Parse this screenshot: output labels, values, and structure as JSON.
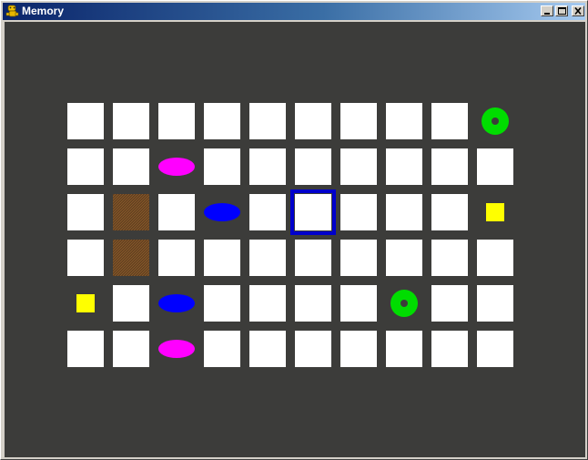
{
  "window": {
    "title": "Memory",
    "controls": [
      "minimize",
      "maximize",
      "close"
    ]
  },
  "colors": {
    "board_background": "#3c3c3a",
    "covered_tile": "#ffffff",
    "highlight": "#0000cc",
    "green": "#00dd00",
    "magenta": "#ff00ff",
    "blue": "#0000ff",
    "yellow": "#ffff00",
    "brown": "#8b5a2b"
  },
  "board": {
    "columns": 10,
    "rows": 6,
    "selected": {
      "row": 2,
      "col": 5
    },
    "cells": [
      [
        {
          "state": "covered"
        },
        {
          "state": "covered"
        },
        {
          "state": "covered"
        },
        {
          "state": "covered"
        },
        {
          "state": "covered"
        },
        {
          "state": "covered"
        },
        {
          "state": "covered"
        },
        {
          "state": "covered"
        },
        {
          "state": "covered"
        },
        {
          "state": "revealed",
          "shape": "donut",
          "color": "green"
        }
      ],
      [
        {
          "state": "covered"
        },
        {
          "state": "covered"
        },
        {
          "state": "revealed",
          "shape": "oval",
          "color": "magenta"
        },
        {
          "state": "covered"
        },
        {
          "state": "covered"
        },
        {
          "state": "covered"
        },
        {
          "state": "covered"
        },
        {
          "state": "covered"
        },
        {
          "state": "covered"
        },
        {
          "state": "covered"
        }
      ],
      [
        {
          "state": "covered"
        },
        {
          "state": "revealed",
          "shape": "lines",
          "color": "brown"
        },
        {
          "state": "covered"
        },
        {
          "state": "revealed",
          "shape": "oval",
          "color": "blue"
        },
        {
          "state": "covered"
        },
        {
          "state": "covered"
        },
        {
          "state": "covered"
        },
        {
          "state": "covered"
        },
        {
          "state": "covered"
        },
        {
          "state": "revealed",
          "shape": "square",
          "color": "yellow"
        }
      ],
      [
        {
          "state": "covered"
        },
        {
          "state": "revealed",
          "shape": "lines",
          "color": "brown"
        },
        {
          "state": "covered"
        },
        {
          "state": "covered"
        },
        {
          "state": "covered"
        },
        {
          "state": "covered"
        },
        {
          "state": "covered"
        },
        {
          "state": "covered"
        },
        {
          "state": "covered"
        },
        {
          "state": "covered"
        }
      ],
      [
        {
          "state": "revealed",
          "shape": "square",
          "color": "yellow"
        },
        {
          "state": "covered"
        },
        {
          "state": "revealed",
          "shape": "oval",
          "color": "blue"
        },
        {
          "state": "covered"
        },
        {
          "state": "covered"
        },
        {
          "state": "covered"
        },
        {
          "state": "covered"
        },
        {
          "state": "revealed",
          "shape": "donut",
          "color": "green"
        },
        {
          "state": "covered"
        },
        {
          "state": "covered"
        }
      ],
      [
        {
          "state": "covered"
        },
        {
          "state": "covered"
        },
        {
          "state": "revealed",
          "shape": "oval",
          "color": "magenta"
        },
        {
          "state": "covered"
        },
        {
          "state": "covered"
        },
        {
          "state": "covered"
        },
        {
          "state": "covered"
        },
        {
          "state": "covered"
        },
        {
          "state": "covered"
        },
        {
          "state": "covered"
        }
      ]
    ]
  }
}
